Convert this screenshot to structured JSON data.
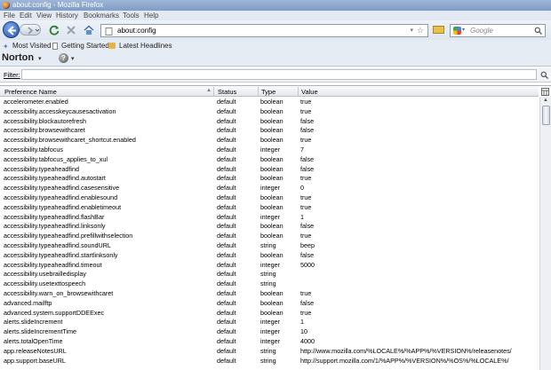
{
  "window": {
    "title": "about:config - Mozilla Firefox"
  },
  "menu": [
    "File",
    "Edit",
    "View",
    "History",
    "Bookmarks",
    "Tools",
    "Help"
  ],
  "navigation": {
    "url": "about:config",
    "search_placeholder": "Google"
  },
  "bookmarks": [
    {
      "label": "Most Visited",
      "icon": "star-folder-icon"
    },
    {
      "label": "Getting Started",
      "icon": "page-icon"
    },
    {
      "label": "Latest Headlines",
      "icon": "rss-folder-icon"
    }
  ],
  "toolbar": {
    "norton_label": "Norton",
    "help_icon": "question-icon"
  },
  "filter": {
    "label": "Filter:",
    "value": ""
  },
  "table": {
    "columns": [
      "Preference Name",
      "Status",
      "Type",
      "Value"
    ],
    "rows": [
      [
        "accelerometer.enabled",
        "default",
        "boolean",
        "true"
      ],
      [
        "accessibility.accesskeycausesactivation",
        "default",
        "boolean",
        "true"
      ],
      [
        "accessibility.blockautorefresh",
        "default",
        "boolean",
        "false"
      ],
      [
        "accessibility.browsewithcaret",
        "default",
        "boolean",
        "false"
      ],
      [
        "accessibility.browsewithcaret_shortcut.enabled",
        "default",
        "boolean",
        "true"
      ],
      [
        "accessibility.tabfocus",
        "default",
        "integer",
        "7"
      ],
      [
        "accessibility.tabfocus_applies_to_xul",
        "default",
        "boolean",
        "false"
      ],
      [
        "accessibility.typeaheadfind",
        "default",
        "boolean",
        "false"
      ],
      [
        "accessibility.typeaheadfind.autostart",
        "default",
        "boolean",
        "true"
      ],
      [
        "accessibility.typeaheadfind.casesensitive",
        "default",
        "integer",
        "0"
      ],
      [
        "accessibility.typeaheadfind.enablesound",
        "default",
        "boolean",
        "true"
      ],
      [
        "accessibility.typeaheadfind.enabletimeout",
        "default",
        "boolean",
        "true"
      ],
      [
        "accessibility.typeaheadfind.flashBar",
        "default",
        "integer",
        "1"
      ],
      [
        "accessibility.typeaheadfind.linksonly",
        "default",
        "boolean",
        "false"
      ],
      [
        "accessibility.typeaheadfind.prefillwithselection",
        "default",
        "boolean",
        "true"
      ],
      [
        "accessibility.typeaheadfind.soundURL",
        "default",
        "string",
        "beep"
      ],
      [
        "accessibility.typeaheadfind.startlinksonly",
        "default",
        "boolean",
        "false"
      ],
      [
        "accessibility.typeaheadfind.timeout",
        "default",
        "integer",
        "5000"
      ],
      [
        "accessibility.usebrailledisplay",
        "default",
        "string",
        ""
      ],
      [
        "accessibility.usetexttospeech",
        "default",
        "string",
        ""
      ],
      [
        "accessibility.warn_on_browsewithcaret",
        "default",
        "boolean",
        "true"
      ],
      [
        "advanced.mailftp",
        "default",
        "boolean",
        "false"
      ],
      [
        "advanced.system.supportDDEExec",
        "default",
        "boolean",
        "true"
      ],
      [
        "alerts.slideIncrement",
        "default",
        "integer",
        "1"
      ],
      [
        "alerts.slideIncrementTime",
        "default",
        "integer",
        "10"
      ],
      [
        "alerts.totalOpenTime",
        "default",
        "integer",
        "4000"
      ],
      [
        "app.releaseNotesURL",
        "default",
        "string",
        "http://www.mozilla.com/%LOCALE%/%APP%/%VERSION%/releasenotes/"
      ],
      [
        "app.support.baseURL",
        "default",
        "string",
        "http://support.mozilla.com/1/%APP%/%VERSION%/%OS%/%LOCALE%/"
      ]
    ]
  },
  "colors": {
    "titlebar": "#8aa5cd",
    "toolbar": "#e6ecf4",
    "back_button": "#2456b3"
  }
}
